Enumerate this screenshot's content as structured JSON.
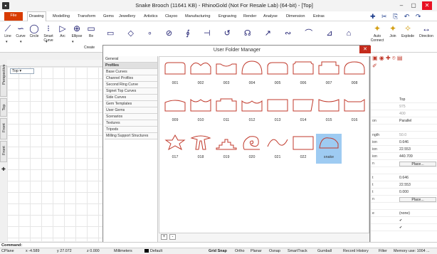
{
  "window": {
    "title": "Snake Brooch (11641 KB) - RhinoGold (Not For Resale Lab) (64-bit) - [Top]",
    "minimize": "–",
    "maximize": "▢",
    "close": "✕"
  },
  "menu": [
    "File",
    "Drawing",
    "Modelling",
    "Transform",
    "Gems",
    "Jewellery",
    "Artistics",
    "Clayoo",
    "Manufacturing",
    "Engraving",
    "Render",
    "Analyse",
    "Dimension",
    "Extras"
  ],
  "toolbar": {
    "tools": [
      {
        "label": "Line",
        "icon": "⟋"
      },
      {
        "label": "Curve",
        "icon": "∽"
      },
      {
        "label": "Circle",
        "icon": "◯"
      },
      {
        "label": "Smart Curve",
        "icon": "⁝"
      },
      {
        "label": "Arc",
        "icon": "▷"
      },
      {
        "label": "Ellipse",
        "icon": "⊕"
      },
      {
        "label": "Re",
        "icon": "▭"
      }
    ],
    "create_label": "Create",
    "right_tools": [
      {
        "label": "Auto Connect",
        "icon": "✎"
      },
      {
        "label": "Join",
        "icon": "✎"
      },
      {
        "label": "Explode",
        "icon": "✎"
      },
      {
        "label": "Direction",
        "icon": "↔"
      }
    ]
  },
  "viewport": {
    "label": "Top",
    "tabs": [
      "Perspective",
      "Top",
      "Front",
      "Front"
    ]
  },
  "dialog": {
    "title": "User Folder Manager",
    "categories": [
      {
        "label": "General",
        "selected": false
      },
      {
        "label": "Profiles",
        "selected": true
      },
      {
        "label": "Base Curves",
        "selected": false
      },
      {
        "label": "Channel Profiles",
        "selected": false
      },
      {
        "label": "Second Ring Curve",
        "selected": false
      },
      {
        "label": "Signet Top Curves",
        "selected": false
      },
      {
        "label": "Side Curves",
        "selected": false
      },
      {
        "label": "Gem Templates",
        "selected": false
      },
      {
        "label": "User Gems",
        "selected": false
      },
      {
        "label": "Scenarios",
        "selected": false
      },
      {
        "label": "Textures",
        "selected": false
      },
      {
        "label": "Tripods",
        "selected": false
      },
      {
        "label": "Milling Support Structures",
        "selected": false
      }
    ],
    "items": [
      "001",
      "002",
      "003",
      "004",
      "005",
      "006",
      "007",
      "008",
      "009",
      "010",
      "011",
      "012",
      "013",
      "014",
      "015",
      "016",
      "017",
      "018",
      "019",
      "020",
      "021",
      "022",
      "snake"
    ],
    "selected_item": "snake",
    "add_label": "+",
    "remove_label": "-",
    "profile_color": "#c0392b"
  },
  "properties": {
    "rows": [
      {
        "k": "",
        "v": "Top",
        "grey": false
      },
      {
        "k": "",
        "v": "975",
        "grey": true
      },
      {
        "k": "",
        "v": "400",
        "grey": true
      },
      {
        "k": "on",
        "v": "Parallel",
        "grey": false
      },
      {
        "k": "",
        "v": "",
        "grey": false
      },
      {
        "k": "ngth",
        "v": "50.0",
        "grey": true
      },
      {
        "k": "ion",
        "v": "0.646",
        "grey": false
      },
      {
        "k": "ion",
        "v": "22.553",
        "grey": false
      },
      {
        "k": "ion",
        "v": "440.709",
        "grey": false
      },
      {
        "k": "n",
        "v": "Place...",
        "grey": false,
        "button": true
      },
      {
        "k": "",
        "v": "",
        "grey": false
      },
      {
        "k": "t",
        "v": "0.646",
        "grey": false
      },
      {
        "k": "t",
        "v": "22.553",
        "grey": false
      },
      {
        "k": "t",
        "v": "0.000",
        "grey": false
      },
      {
        "k": "n",
        "v": "Place...",
        "grey": false,
        "button": true
      },
      {
        "k": "",
        "v": "",
        "grey": false
      },
      {
        "k": "e",
        "v": "(none)",
        "grey": false
      },
      {
        "k": "",
        "v": "✔",
        "grey": false
      },
      {
        "k": "",
        "v": "✔",
        "grey": false
      }
    ]
  },
  "command": {
    "label": "Command:"
  },
  "status": {
    "cplane": "CPlane",
    "x": "x -4.589",
    "y": "y 27.072",
    "z": "z 0.000",
    "units": "Millimeters",
    "layer": "Default",
    "grid_snap": "Grid Snap",
    "ortho": "Ortho",
    "planar": "Planar",
    "osnap": "Osnap",
    "smarttrack": "SmartTrack",
    "gumball": "Gumball",
    "record_history": "Record History",
    "filter": "Filter",
    "memory": "Memory use: 1004 ..."
  }
}
